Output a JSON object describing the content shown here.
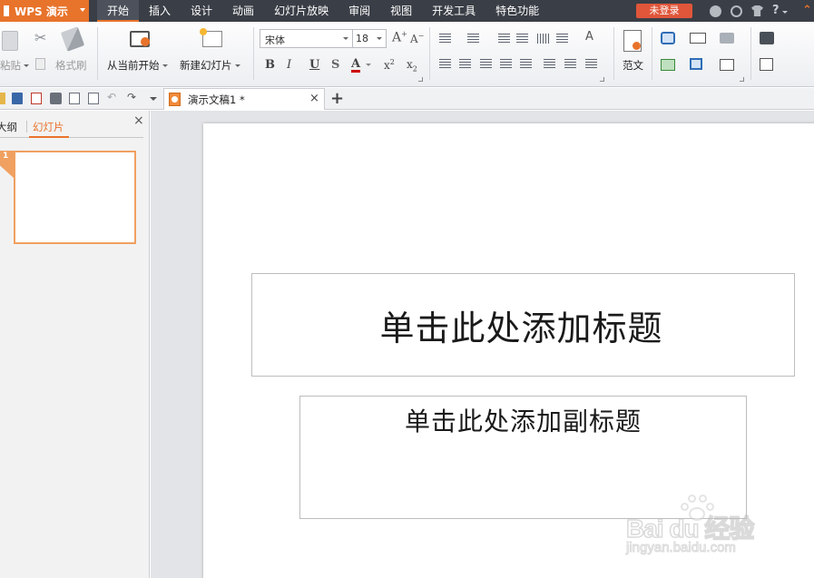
{
  "menubar": {
    "app_name": "WPS 演示",
    "tabs": [
      {
        "label": "开始",
        "active": true
      },
      {
        "label": "插入"
      },
      {
        "label": "设计"
      },
      {
        "label": "动画"
      },
      {
        "label": "幻灯片放映"
      },
      {
        "label": "审阅"
      },
      {
        "label": "视图"
      },
      {
        "label": "开发工具"
      },
      {
        "label": "特色功能"
      }
    ],
    "login_label": "未登录",
    "help_glyph": "?",
    "accent_color": "#e8732b",
    "login_color": "#e0563a",
    "bar_color": "#3a3e46"
  },
  "ribbon": {
    "paste_label": "粘贴",
    "format_painter_label": "格式刷",
    "from_current_label": "从当前开始",
    "new_slide_label": "新建幻灯片",
    "font_name": "宋体",
    "font_size": "18",
    "template_label": "范文",
    "icons": [
      "cut-icon",
      "copy-icon",
      "format-painter-icon",
      "play-from-current-icon",
      "new-slide-icon",
      "grow-font-icon",
      "shrink-font-icon",
      "bold-icon",
      "italic-icon",
      "underline-icon",
      "shadow-icon",
      "font-color-icon",
      "superscript-icon",
      "subscript-icon",
      "bullets-icon",
      "numbering-icon",
      "outdent-icon",
      "indent-icon",
      "text-direction-icon",
      "align-text-icon",
      "align-left-icon",
      "align-center-icon",
      "align-right-icon",
      "justify-icon",
      "distribute-icon",
      "line-spacing-icon",
      "paragraph-spacing-icon",
      "template-icon",
      "shapes-icon",
      "textbox-icon",
      "fill-icon",
      "picture-icon",
      "arrange-icon",
      "outline-icon",
      "find-icon",
      "select-icon"
    ]
  },
  "quickbar": {
    "doc_tab_title": "演示文稿1 *",
    "close_glyph": "×",
    "new_tab_glyph": "+"
  },
  "leftpane": {
    "tab_outline": "大纲",
    "tab_slides": "幻灯片",
    "close_glyph": "×",
    "slide_number": "1"
  },
  "slide": {
    "title_placeholder": "单击此处添加标题",
    "subtitle_placeholder": "单击此处添加副标题"
  },
  "watermark": {
    "brand": "Bai du 经验",
    "url": "jingyan.baidu.com"
  }
}
